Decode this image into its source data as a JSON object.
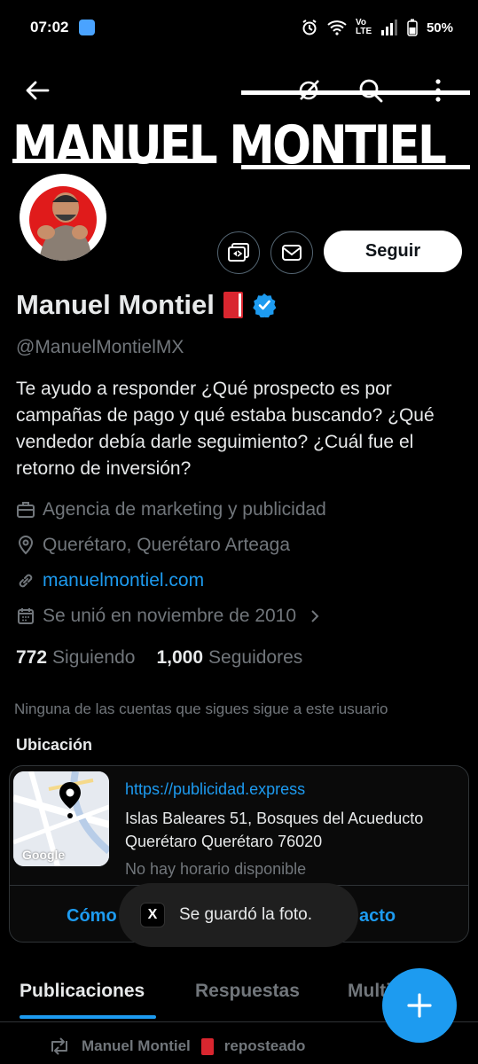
{
  "status_bar": {
    "time": "07:02",
    "network_label": "Vo LTE",
    "battery": "50%",
    "icons": [
      "weather-icon",
      "alarm-icon",
      "wifi-icon",
      "signal-icon",
      "battery-icon"
    ]
  },
  "banner": {
    "text": "MANUEL MONTIEL"
  },
  "top_actions": {
    "icons": [
      "back-arrow-icon",
      "grok-icon",
      "search-icon",
      "more-vertical-icon"
    ]
  },
  "profile": {
    "name": "Manuel Montiel",
    "handle": "@ManuelMontielMX",
    "bio": "Te ayudo a responder  ¿Qué prospecto es por campañas de pago y qué estaba buscando? ¿Qué vendedor debía darle seguimiento?  ¿Cuál fue el retorno de inversión?",
    "category": "Agencia de marketing y publicidad",
    "location": "Querétaro, Querétaro Arteaga",
    "website": "manuelmontiel.com",
    "joined": "Se unió en noviembre de 2010",
    "following_count": "772",
    "following_label": "Siguiendo",
    "followers_count": "1,000",
    "followers_label": "Seguidores",
    "not_followed_note": "Ninguna de las cuentas que sigues sigue a este usuario",
    "verified_color": "#1d9bf0"
  },
  "actions": {
    "follow_label": "Seguir"
  },
  "location_card": {
    "title": "Ubicación",
    "url": "https://publicidad.express",
    "address_line1": "Islas Baleares 51, Bosques del Acueducto",
    "address_line2": "Querétaro Querétaro 76020",
    "hours": "No hay horario disponible",
    "map_label": "Google",
    "action_left": "Cómo",
    "action_right": "acto"
  },
  "toast": {
    "icon_label": "X",
    "text": "Se guardó la foto."
  },
  "tabs": [
    {
      "label": "Publicaciones",
      "active": true
    },
    {
      "label": "Respuestas",
      "active": false
    },
    {
      "label": "Multi",
      "active": false
    }
  ],
  "repost": {
    "text": "Manuel Montiel",
    "suffix": "reposteado"
  },
  "colors": {
    "accent": "#1d9bf0",
    "background": "#000000",
    "secondary_text": "#71767b"
  }
}
